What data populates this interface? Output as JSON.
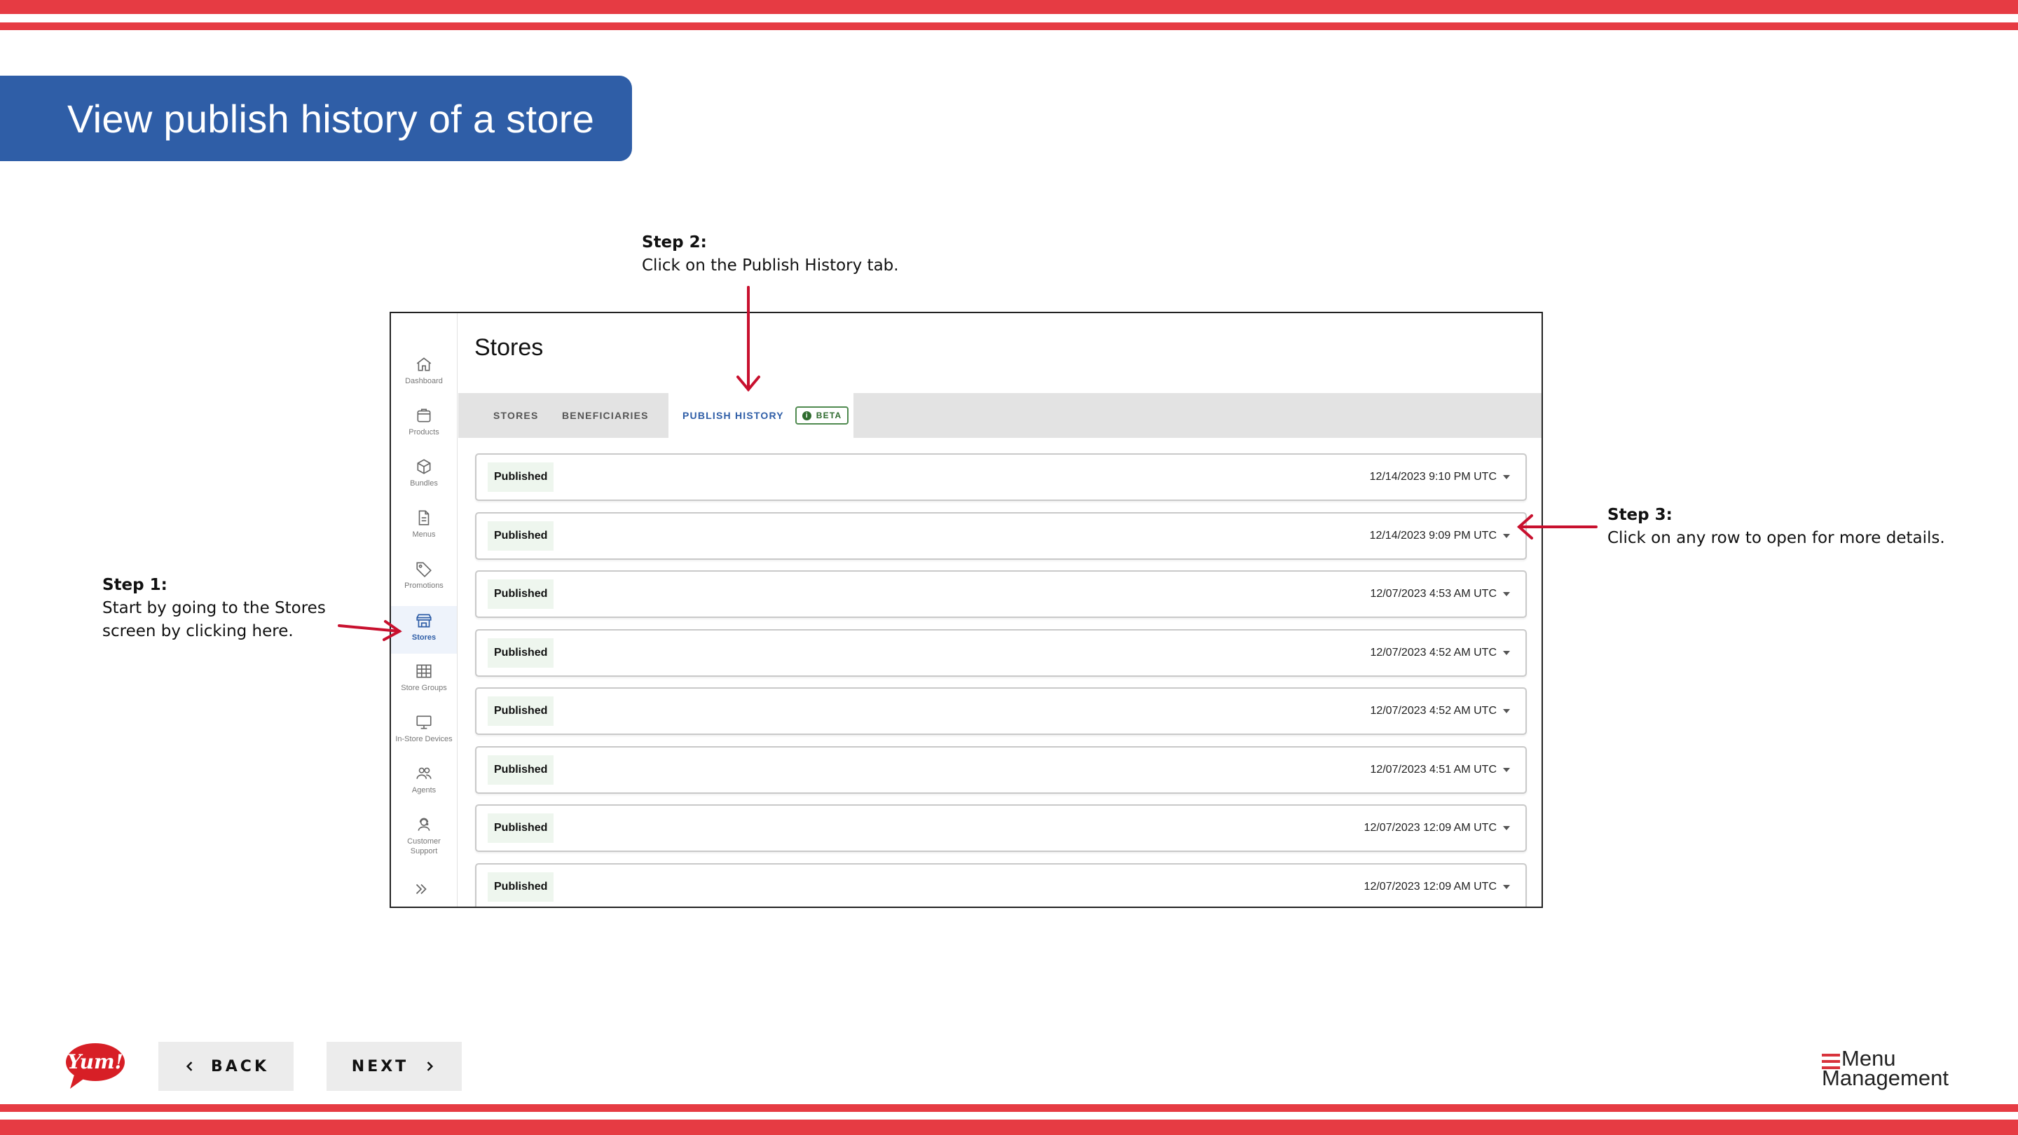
{
  "colors": {
    "stripe_red": "#e63b43",
    "banner_blue": "#2f5ea7",
    "arrow_red": "#c8102e",
    "beta_green": "#2e6b2e"
  },
  "slide": {
    "title": "View publish history of a store"
  },
  "steps": {
    "step1": {
      "title": "Step 1:",
      "line1": "Start by going to the Stores",
      "line2": "screen by clicking here."
    },
    "step2": {
      "title": "Step 2:",
      "line1": "Click on the Publish History tab."
    },
    "step3": {
      "title": "Step 3:",
      "line1": "Click on any row to open for more details."
    }
  },
  "app": {
    "page_title": "Stores",
    "sidebar": [
      {
        "label": "Dashboard",
        "icon": "home-icon"
      },
      {
        "label": "Products",
        "icon": "products-icon"
      },
      {
        "label": "Bundles",
        "icon": "cube-icon"
      },
      {
        "label": "Menus",
        "icon": "document-icon"
      },
      {
        "label": "Promotions",
        "icon": "tag-icon"
      },
      {
        "label": "Stores",
        "icon": "storefront-icon",
        "active": true
      },
      {
        "label": "Store Groups",
        "icon": "grid-icon"
      },
      {
        "label": "In-Store Devices",
        "icon": "monitor-icon"
      },
      {
        "label": "Agents",
        "icon": "people-icon"
      },
      {
        "label": "Customer",
        "label2": "Support",
        "icon": "support-agent-icon"
      }
    ],
    "collapse_icon": "double-chevron-right-icon",
    "tabs": {
      "stores": "STORES",
      "beneficiaries": "BENEFICIARIES",
      "publish_history": "PUBLISH HISTORY",
      "beta": "BETA"
    },
    "history": [
      {
        "status": "Published",
        "timestamp": "12/14/2023 9:10 PM UTC"
      },
      {
        "status": "Published",
        "timestamp": "12/14/2023 9:09 PM UTC"
      },
      {
        "status": "Published",
        "timestamp": "12/07/2023 4:53 AM UTC"
      },
      {
        "status": "Published",
        "timestamp": "12/07/2023 4:52 AM UTC"
      },
      {
        "status": "Published",
        "timestamp": "12/07/2023 4:52 AM UTC"
      },
      {
        "status": "Published",
        "timestamp": "12/07/2023 4:51 AM UTC"
      },
      {
        "status": "Published",
        "timestamp": "12/07/2023 12:09 AM UTC"
      },
      {
        "status": "Published",
        "timestamp": "12/07/2023 12:09 AM UTC"
      }
    ]
  },
  "nav": {
    "back": "BACK",
    "next": "NEXT"
  },
  "branding": {
    "yum_logo_text": "Yum!",
    "mm_word1": "Menu",
    "mm_word2": "Management"
  }
}
